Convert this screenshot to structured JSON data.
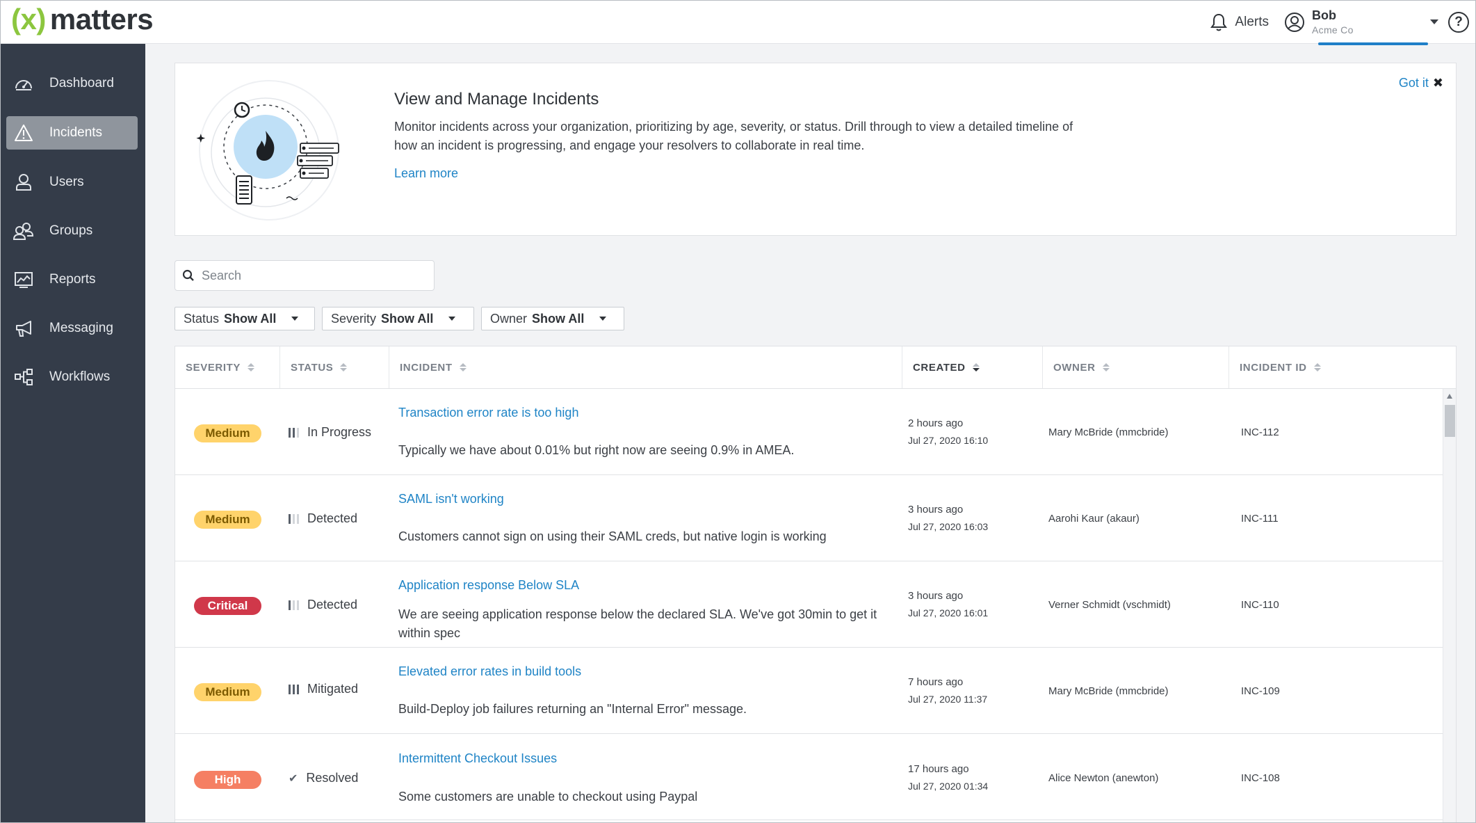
{
  "app": {
    "logo_prefix": "(x)",
    "logo_text": "matters"
  },
  "header": {
    "alerts_label": "Alerts",
    "user_name": "Bob",
    "user_org": "Acme Co",
    "help_label": "?"
  },
  "sidebar": {
    "items": [
      {
        "label": "Dashboard",
        "icon": "gauge-icon",
        "active": false
      },
      {
        "label": "Incidents",
        "icon": "warning-icon",
        "active": true
      },
      {
        "label": "Users",
        "icon": "user-icon",
        "active": false
      },
      {
        "label": "Groups",
        "icon": "group-icon",
        "active": false
      },
      {
        "label": "Reports",
        "icon": "chart-icon",
        "active": false
      },
      {
        "label": "Messaging",
        "icon": "megaphone-icon",
        "active": false
      },
      {
        "label": "Workflows",
        "icon": "workflow-icon",
        "active": false
      }
    ]
  },
  "banner": {
    "title": "View and Manage Incidents",
    "text": "Monitor incidents across your organization, prioritizing by age, severity, or status. Drill through to view a detailed timeline of how an incident is progressing, and engage your resolvers to collaborate in real time.",
    "link": "Learn more",
    "dismiss": "Got it"
  },
  "search": {
    "placeholder": "Search"
  },
  "filters": [
    {
      "label": "Status",
      "value": "Show All"
    },
    {
      "label": "Severity",
      "value": "Show All"
    },
    {
      "label": "Owner",
      "value": "Show All"
    }
  ],
  "table": {
    "columns": [
      "SEVERITY",
      "STATUS",
      "INCIDENT",
      "CREATED",
      "OWNER",
      "INCIDENT ID"
    ],
    "rows": [
      {
        "severity": "Medium",
        "status": "In Progress",
        "status_level": 2,
        "title": "Transaction error rate is too high",
        "description": "Typically we have about 0.01% but right now are seeing 0.9% in AMEA.",
        "created_rel": "2 hours ago",
        "created_ts": "Jul 27, 2020 16:10",
        "owner": "Mary McBride (mmcbride)",
        "id": "INC-112"
      },
      {
        "severity": "Medium",
        "status": "Detected",
        "status_level": 1,
        "title": "SAML isn't working",
        "description": "Customers cannot sign on using their SAML creds, but native login is working",
        "created_rel": "3 hours ago",
        "created_ts": "Jul 27, 2020 16:03",
        "owner": "Aarohi Kaur (akaur)",
        "id": "INC-111"
      },
      {
        "severity": "Critical",
        "status": "Detected",
        "status_level": 1,
        "title": "Application response Below SLA",
        "description": "We are seeing application response below the declared SLA. We've got 30min to get it within spec",
        "created_rel": "3 hours ago",
        "created_ts": "Jul 27, 2020 16:01",
        "owner": "Verner Schmidt (vschmidt)",
        "id": "INC-110"
      },
      {
        "severity": "Medium",
        "status": "Mitigated",
        "status_level": 3,
        "title": "Elevated error rates in build tools",
        "description": "Build-Deploy job failures returning an \"Internal Error\" message.",
        "created_rel": "7 hours ago",
        "created_ts": "Jul 27, 2020 11:37",
        "owner": "Mary McBride (mmcbride)",
        "id": "INC-109"
      },
      {
        "severity": "High",
        "status": "Resolved",
        "status_level": 4,
        "title": "Intermittent Checkout Issues",
        "description": "Some customers are unable to checkout using Paypal",
        "created_rel": "17 hours ago",
        "created_ts": "Jul 27, 2020 01:34",
        "owner": "Alice Newton (anewton)",
        "id": "INC-108"
      }
    ]
  },
  "colors": {
    "sidebar_bg": "#343c49",
    "accent_link": "#1f84c6",
    "brand_green": "#8cc63f",
    "severity_medium": "#ffd36b",
    "severity_critical": "#d0384a",
    "severity_high": "#f57f63"
  }
}
